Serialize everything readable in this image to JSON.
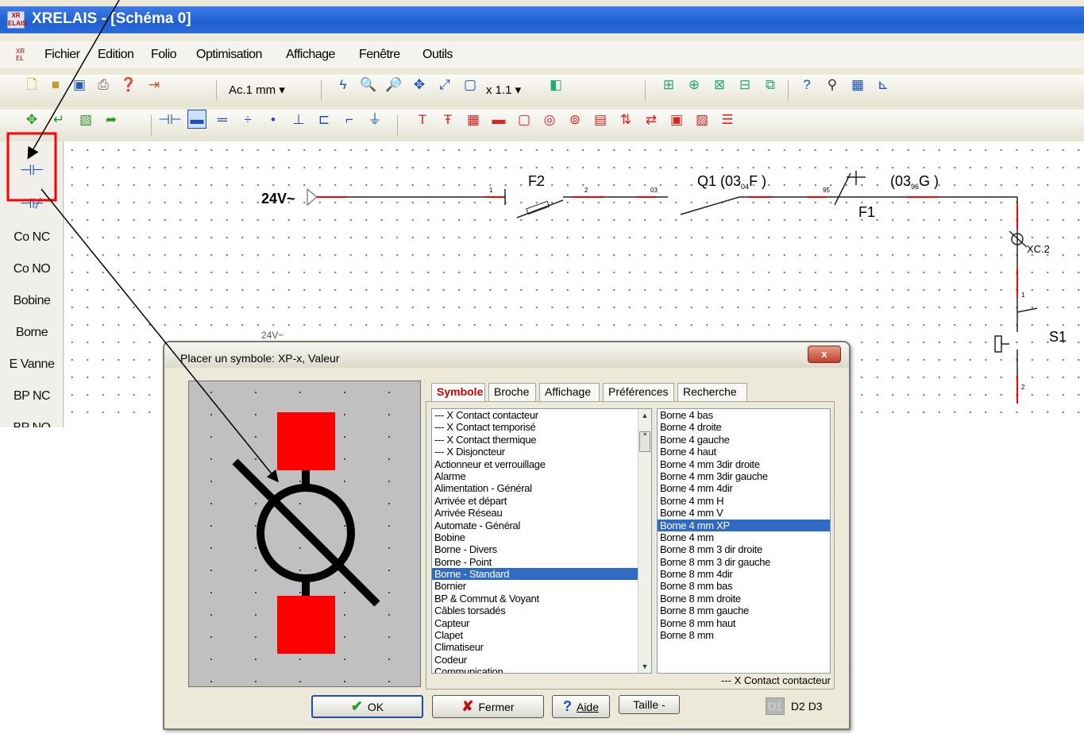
{
  "window": {
    "app_name": "XRELAIS",
    "doc_title": " - [Schéma 0]"
  },
  "menu": [
    "Fichier",
    "Edition",
    "Folio",
    "Optimisation",
    "Affichage",
    "Fenêtre",
    "Outils"
  ],
  "toolbar1": {
    "grid_value": "Ac.1 mm ▾",
    "zoom_value": "x 1.1 ▾"
  },
  "left_panel": {
    "items": [
      "Co NC",
      "Co NO",
      "Bobine",
      "Borne",
      "E Vanne",
      "BP NC",
      "BP NO"
    ]
  },
  "schematic": {
    "supply": "24V~",
    "supply2": "24V~",
    "fuse": "F2",
    "relay": "F1",
    "contactor": "Q1",
    "contactor_ref": "(03",
    "contactor_ref_sub": "04",
    "contactor_ref_end": "F )",
    "relay_ref": "(03",
    "relay_ref_sub": "96",
    "relay_ref_end": "G )",
    "pin1": "1",
    "pin2": "2",
    "pin03": "03",
    "pin95": "95",
    "terminal": "XC.2",
    "pb": "S1",
    "pb_pin1": "1",
    "pb_pin2": "2"
  },
  "dialog": {
    "title": "Placer un symbole: XP-x, Valeur",
    "close_label": "x",
    "tabs": [
      "Symbole",
      "Broche",
      "Affichage",
      "Préférences",
      "Recherche"
    ],
    "active_tab": "Symbole",
    "categories": [
      "--- X Contact contacteur",
      "--- X Contact temporisé",
      "--- X Contact thermique",
      "--- X Disjoncteur",
      "Actionneur et verrouillage",
      "Alarme",
      "Alimentation - Général",
      "Arrivée et départ",
      "Arrivée Réseau",
      "Automate - Général",
      "Bobine",
      "Borne - Divers",
      "Borne - Point",
      "Borne - Standard",
      "Bornier",
      "BP & Commut & Voyant",
      "Câbles torsadés",
      "Capteur",
      "Clapet",
      "Climatiseur",
      "Codeur",
      "Communication"
    ],
    "selected_category": "Borne - Standard",
    "symbols": [
      "Borne 4 bas",
      "Borne 4 droite",
      "Borne 4 gauche",
      "Borne 4 haut",
      "Borne 4 mm 3dir droite",
      "Borne 4 mm 3dir gauche",
      "Borne 4 mm 4dir",
      "Borne 4 mm H",
      "Borne 4 mm V",
      "Borne 4 mm XP",
      "Borne 4 mm",
      "Borne 8 mm 3 dir droite",
      "Borne 8 mm 3 dir gauche",
      "Borne 8 mm 4dir",
      "Borne 8 mm bas",
      "Borne 8 mm droite",
      "Borne 8 mm gauche",
      "Borne 8 mm haut",
      "Borne 8 mm"
    ],
    "selected_symbol": "Borne 4 mm XP",
    "status": "--- X Contact contacteur",
    "buttons": {
      "ok": "OK",
      "close": "Fermer",
      "help": "Aide",
      "size": "Taille -"
    },
    "d_options": [
      "D1",
      "D2",
      "D3"
    ]
  },
  "colors": {
    "accent_red": "#ff0000",
    "selection": "#316ac5",
    "titlebar": "#2a68d6"
  }
}
